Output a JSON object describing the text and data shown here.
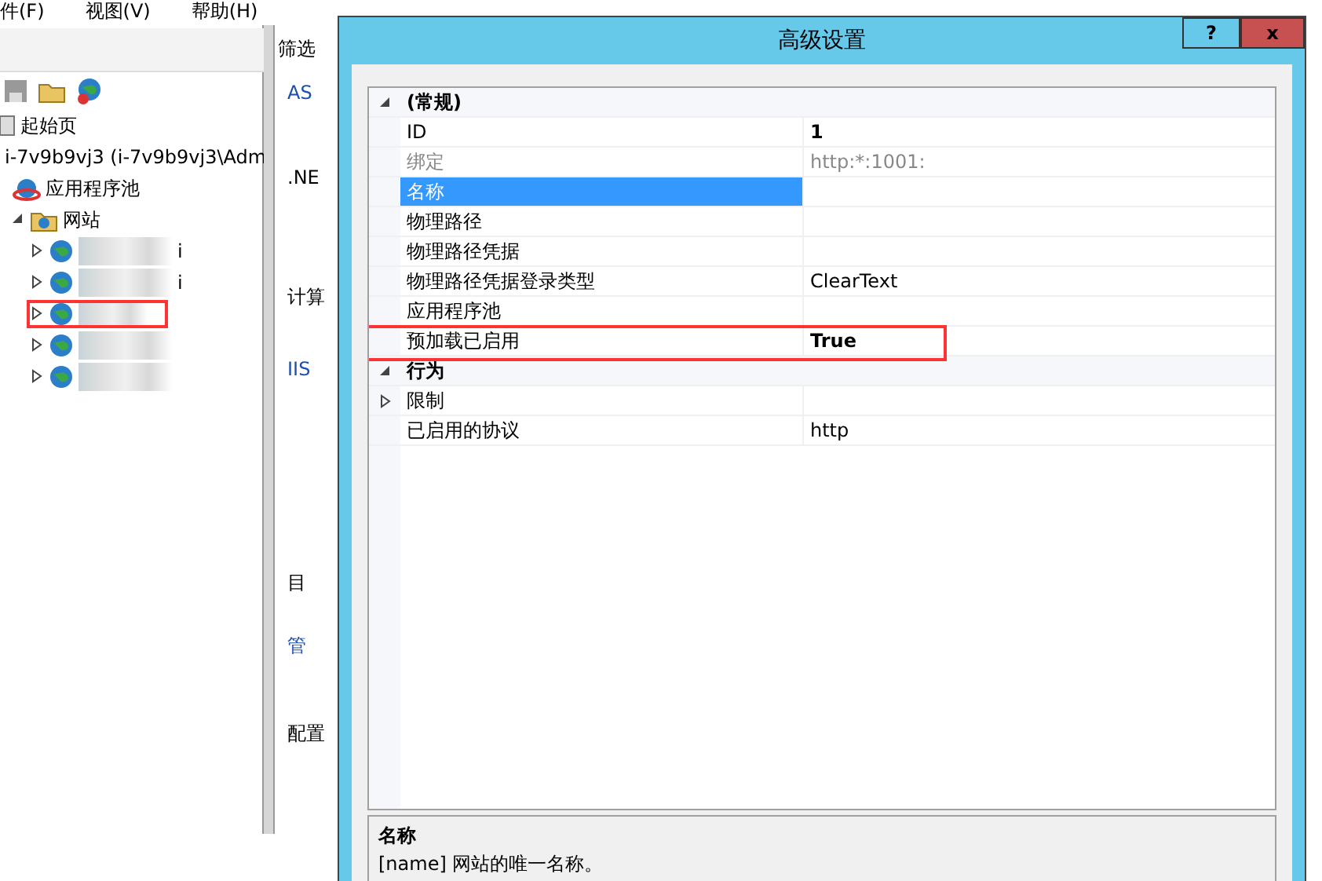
{
  "main_window": {
    "menu": [
      "件(F)",
      "视图(V)",
      "帮助(H)"
    ],
    "tree": [
      {
        "label": "起始页",
        "kind": "page"
      },
      {
        "label": "i-7v9b9vj3 (i-7v9b9vj3\\Adm",
        "kind": "server",
        "children": [
          {
            "label": "应用程序池",
            "kind": "pool"
          },
          {
            "label": "网站",
            "kind": "sites",
            "expanded": true,
            "children": [
              {
                "kind": "site",
                "label": "i",
                "expanded": false
              },
              {
                "kind": "site",
                "label": "i",
                "expanded": false
              },
              {
                "kind": "site",
                "expanded": false,
                "highlighted": true
              },
              {
                "kind": "site",
                "expanded": false
              },
              {
                "kind": "site",
                "expanded": false
              }
            ]
          }
        ]
      }
    ],
    "middle_panel": [
      {
        "kind": "header",
        "text": "筛选"
      },
      {
        "kind": "link",
        "text": "AS"
      },
      {
        "kind": "text",
        "text": ".NE"
      },
      {
        "kind": "text",
        "text": "计算"
      },
      {
        "kind": "link",
        "text": "IIS"
      },
      {
        "kind": "text",
        "text": "目"
      },
      {
        "kind": "link",
        "text": "管"
      },
      {
        "kind": "text",
        "text": "配置"
      }
    ]
  },
  "dialog": {
    "title": "高级设置",
    "help_button": "?",
    "close_button": "x",
    "categories": [
      {
        "name": "(常规)",
        "expanded": true,
        "rows": [
          {
            "name": "ID",
            "value": "1",
            "bold": true,
            "disabled": false,
            "selected": false
          },
          {
            "name": "绑定",
            "value": "http:*:1001:",
            "bold": false,
            "disabled": true,
            "selected": false
          },
          {
            "name": "名称",
            "disabled": false,
            "selected": true
          },
          {
            "name": "物理路径",
            "disabled": false,
            "selected": false
          },
          {
            "name": "物理路径凭据",
            "disabled": false,
            "selected": false
          },
          {
            "name": "物理路径凭据登录类型",
            "value": "ClearText",
            "bold": false,
            "disabled": false,
            "selected": false
          },
          {
            "name": "应用程序池",
            "disabled": false,
            "selected": false
          },
          {
            "name": "预加载已启用",
            "value": "True",
            "bold": true,
            "disabled": false,
            "selected": false,
            "highlighted": true
          }
        ]
      },
      {
        "name": "行为",
        "expanded": true,
        "rows": [
          {
            "name": "限制",
            "expanded": false,
            "disabled": false,
            "selected": false
          },
          {
            "name": "已启用的协议",
            "value": "http",
            "bold": false,
            "disabled": false,
            "selected": false
          }
        ]
      }
    ],
    "description": {
      "title": "名称",
      "text": "[name] 网站的唯一名称。"
    }
  }
}
